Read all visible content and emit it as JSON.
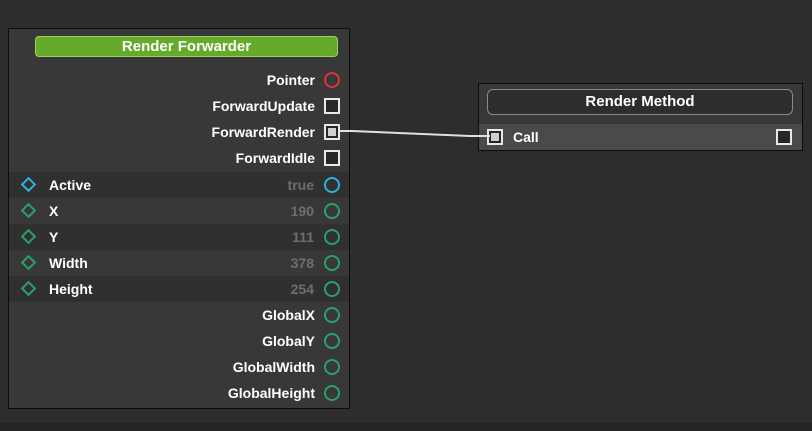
{
  "render_forwarder": {
    "title": "Render Forwarder",
    "outputs": {
      "pointer": "Pointer",
      "forward_update": "ForwardUpdate",
      "forward_render": "ForwardRender",
      "forward_idle": "ForwardIdle"
    },
    "properties": [
      {
        "label": "Active",
        "value": "true"
      },
      {
        "label": "X",
        "value": "190"
      },
      {
        "label": "Y",
        "value": "111"
      },
      {
        "label": "Width",
        "value": "378"
      },
      {
        "label": "Height",
        "value": "254"
      }
    ],
    "globals": {
      "global_x": "GlobalX",
      "global_y": "GlobalY",
      "global_width": "GlobalWidth",
      "global_height": "GlobalHeight"
    }
  },
  "render_method": {
    "title": "Render Method",
    "input_label": "Call"
  },
  "colors": {
    "canvas": "#2d2d2d",
    "node_body": "#383838",
    "header_green": "#66aa2a",
    "port_red": "#e0303a",
    "port_blue": "#2fb1e0",
    "port_green": "#2aa06a",
    "wire": "#e0e0e0"
  }
}
